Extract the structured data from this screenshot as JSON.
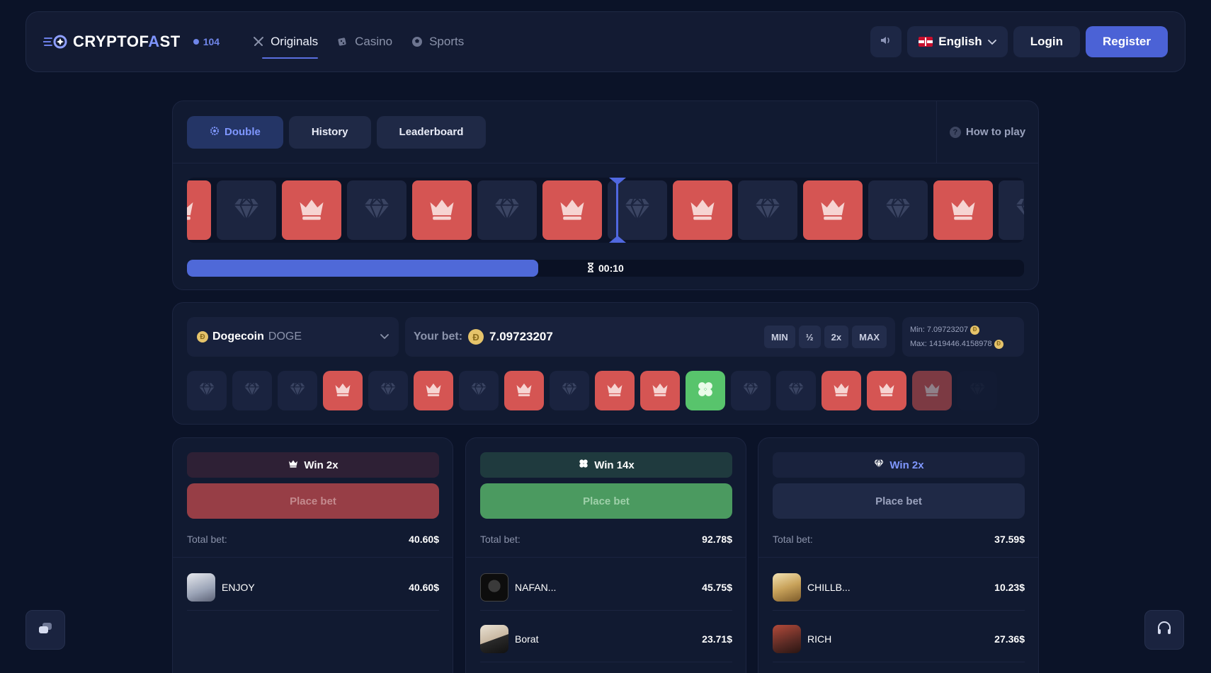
{
  "header": {
    "brand_main": "CRYPTOF",
    "brand_accent": "A",
    "brand_tail": "ST",
    "online_count": "104",
    "nav": [
      {
        "label": "Originals",
        "icon": "swords-icon",
        "active": true
      },
      {
        "label": "Casino",
        "icon": "dice-icon",
        "active": false
      },
      {
        "label": "Sports",
        "icon": "ball-icon",
        "active": false
      }
    ],
    "language": "English",
    "login_label": "Login",
    "register_label": "Register"
  },
  "game": {
    "tabs": [
      {
        "label": "Double",
        "active": true
      },
      {
        "label": "History",
        "active": false
      },
      {
        "label": "Leaderboard",
        "active": false
      }
    ],
    "how_to_play": "How to play",
    "reel": [
      "red",
      "dark",
      "red",
      "dark",
      "red",
      "dark",
      "red",
      "dark",
      "red",
      "dark",
      "red",
      "dark",
      "red",
      "dark"
    ],
    "timer": "00:10",
    "progress": 0.42
  },
  "bet": {
    "coin_name": "Dogecoin",
    "coin_symbol": "DOGE",
    "your_bet_label": "Your bet:",
    "bet_value": "7.09723207",
    "modifiers": [
      "MIN",
      "½",
      "2x",
      "MAX"
    ],
    "min_label": "Min: 7.09723207",
    "max_label": "Max: 1419446.4158978",
    "history": [
      "dark",
      "dark",
      "dark",
      "red",
      "dark",
      "red",
      "dark",
      "red",
      "dark",
      "red",
      "red",
      "green",
      "dark",
      "dark",
      "red",
      "red",
      "red",
      "dark"
    ]
  },
  "columns": [
    {
      "win_label": "Win 2x",
      "icon": "crown-icon",
      "place_label": "Place bet",
      "total_label": "Total bet:",
      "total_value": "40.60$",
      "players": [
        {
          "name": "ENJOY",
          "amount": "40.60$"
        }
      ]
    },
    {
      "win_label": "Win 14x",
      "icon": "clover-icon",
      "place_label": "Place bet",
      "total_label": "Total bet:",
      "total_value": "92.78$",
      "players": [
        {
          "name": "NAFAN...",
          "amount": "45.75$"
        },
        {
          "name": "Borat",
          "amount": "23.71$"
        }
      ]
    },
    {
      "win_label": "Win 2x",
      "icon": "diamond-icon",
      "place_label": "Place bet",
      "total_label": "Total bet:",
      "total_value": "37.59$",
      "players": [
        {
          "name": "CHILLB...",
          "amount": "10.23$"
        },
        {
          "name": "RICH",
          "amount": "27.36$"
        }
      ]
    }
  ],
  "colors": {
    "accent": "#4b62d6",
    "red_tile": "#d55553",
    "green_tile": "#58c46c",
    "dark_tile": "#1c2540"
  }
}
